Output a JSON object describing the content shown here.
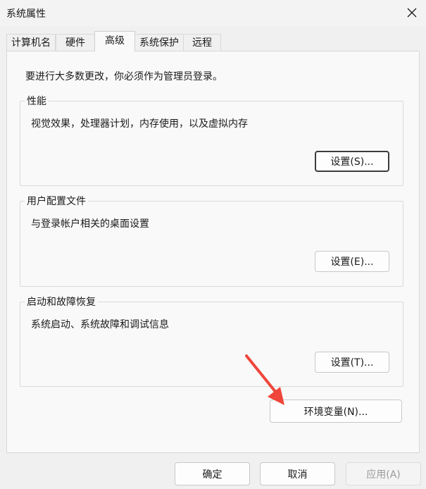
{
  "window": {
    "title": "系统属性"
  },
  "tabs": [
    {
      "label": "计算机名"
    },
    {
      "label": "硬件"
    },
    {
      "label": "高级"
    },
    {
      "label": "系统保护"
    },
    {
      "label": "远程"
    }
  ],
  "active_tab": "高级",
  "main": {
    "admin_note": "要进行大多数更改，你必须作为管理员登录。",
    "performance": {
      "title": "性能",
      "description": "视觉效果，处理器计划，内存使用，以及虚拟内存",
      "button": "设置(S)..."
    },
    "user_profiles": {
      "title": "用户配置文件",
      "description": "与登录帐户相关的桌面设置",
      "button": "设置(E)..."
    },
    "startup_recovery": {
      "title": "启动和故障恢复",
      "description": "系统启动、系统故障和调试信息",
      "button": "设置(T)..."
    },
    "env_button": "环境变量(N)..."
  },
  "footer": {
    "ok": "确定",
    "cancel": "取消",
    "apply": "应用(A)"
  },
  "icons": {
    "close": "close-icon",
    "annotation": "red-arrow-icon"
  },
  "colors": {
    "arrow": "#f0453a"
  }
}
